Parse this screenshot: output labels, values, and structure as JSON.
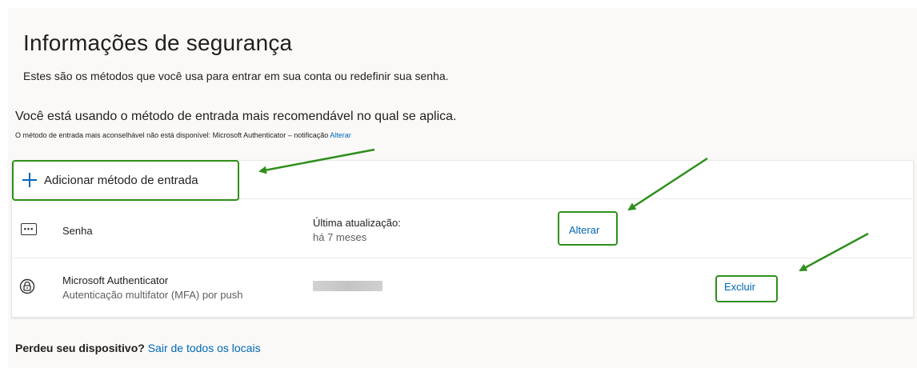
{
  "header": {
    "title": "Informações de segurança",
    "subtitle": "Estes são os métodos que você usa para entrar em sua conta ou redefinir sua senha."
  },
  "recommendation": {
    "main": "Você está usando o método de entrada mais recomendável no qual se aplica.",
    "note": "O método de entrada mais aconselhável não está disponível: Microsoft Authenticator – notificação",
    "note_link": "Alterar"
  },
  "add_method": {
    "label": "Adicionar método de entrada",
    "icon": "plus-icon"
  },
  "methods": [
    {
      "icon": "password-dots-icon",
      "name": "Senha",
      "detail_label": "Última atualização:",
      "detail_value": "há 7 meses",
      "action": "Alterar"
    },
    {
      "icon": "authenticator-lock-icon",
      "name": "Microsoft Authenticator",
      "subtitle": "Autenticação multifator (MFA) por push",
      "detail_value": "",
      "action": "Excluir"
    }
  ],
  "footer": {
    "question": "Perdeu seu dispositivo?",
    "link": "Sair de todos os locais"
  },
  "colors": {
    "accent": "#0067b8",
    "highlight": "#2f8f1c",
    "background": "#faf9f8"
  }
}
